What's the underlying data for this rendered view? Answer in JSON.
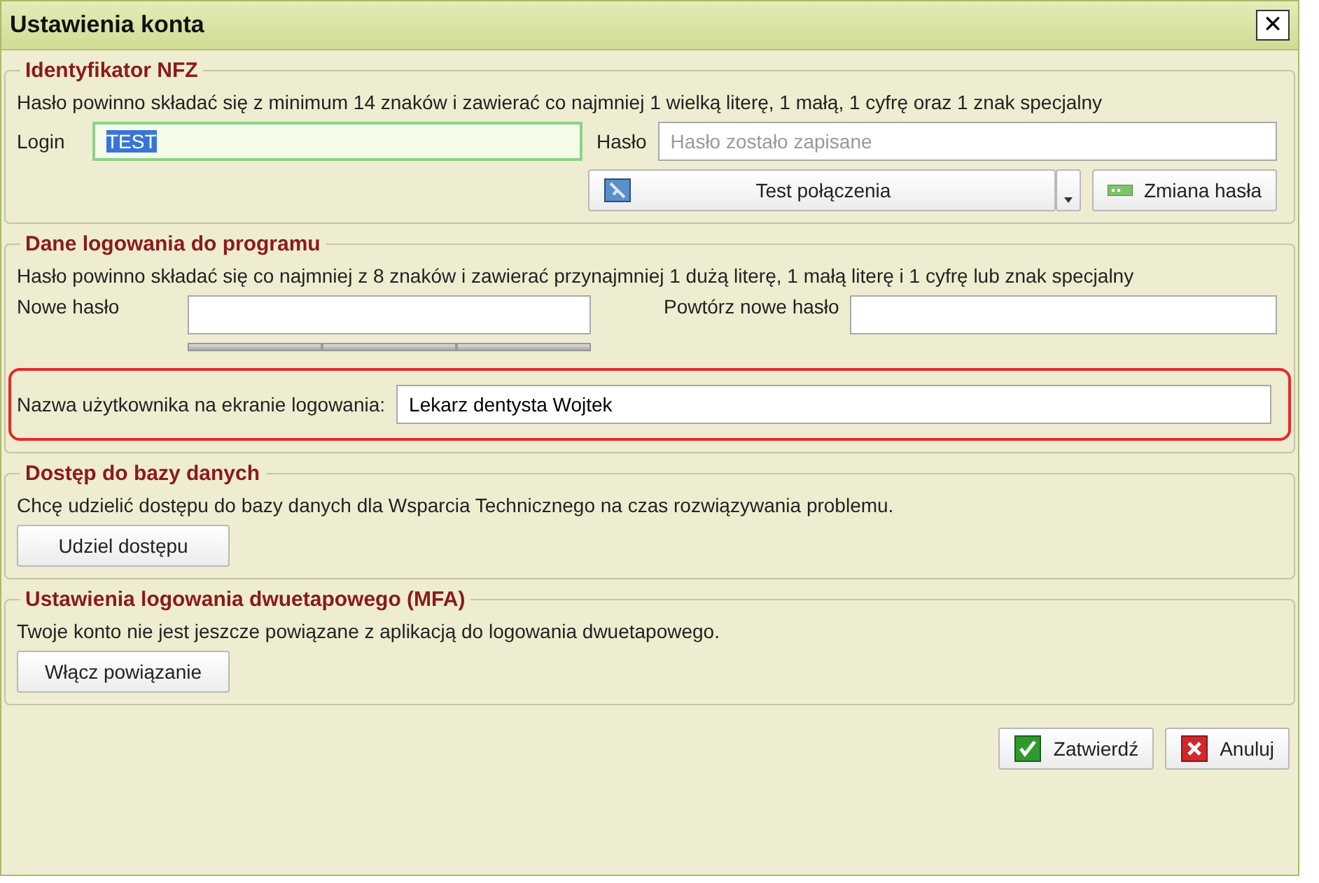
{
  "window": {
    "title": "Ustawienia konta",
    "close": "✕"
  },
  "nfz": {
    "legend": "Identyfikator NFZ",
    "hint": "Hasło powinno składać się z minimum 14 znaków i zawierać co najmniej 1 wielką literę, 1 małą, 1 cyfrę oraz 1 znak specjalny",
    "login_label": "Login",
    "login": {
      "value": "TEST",
      "focused": true,
      "value_selected": true
    },
    "password_label": "Hasło",
    "password": {
      "placeholder": "Hasło zostało zapisane"
    },
    "test_button": "Test połączenia",
    "change_button": "Zmiana hasła"
  },
  "program": {
    "legend": "Dane logowania do programu",
    "hint": "Hasło powinno składać się co najmniej z 8 znaków i zawierać przynajmniej 1 dużą literę, 1 małą literę i 1 cyfrę lub znak specjalny",
    "new_label": "Nowe hasło",
    "repeat_label": "Powtórz nowe hasło",
    "username_label": "Nazwa użytkownika na ekranie logowania:",
    "username": {
      "value": "Lekarz dentysta Wojtek"
    },
    "username_highlighted": true
  },
  "database": {
    "legend": "Dostęp do bazy danych",
    "text": "Chcę udzielić dostępu do bazy danych dla Wsparcia Technicznego na czas rozwiązywania problemu.",
    "button": "Udziel dostępu"
  },
  "mfa": {
    "legend": "Ustawienia logowania dwuetapowego (MFA)",
    "text": "Twoje konto nie jest jeszcze powiązane z aplikacją do logowania dwuetapowego.",
    "button": "Włącz powiązanie"
  },
  "buttons": [
    {
      "kind": "confirm",
      "label": "Zatwierdź"
    },
    {
      "kind": "cancel",
      "label": "Anuluj"
    }
  ]
}
